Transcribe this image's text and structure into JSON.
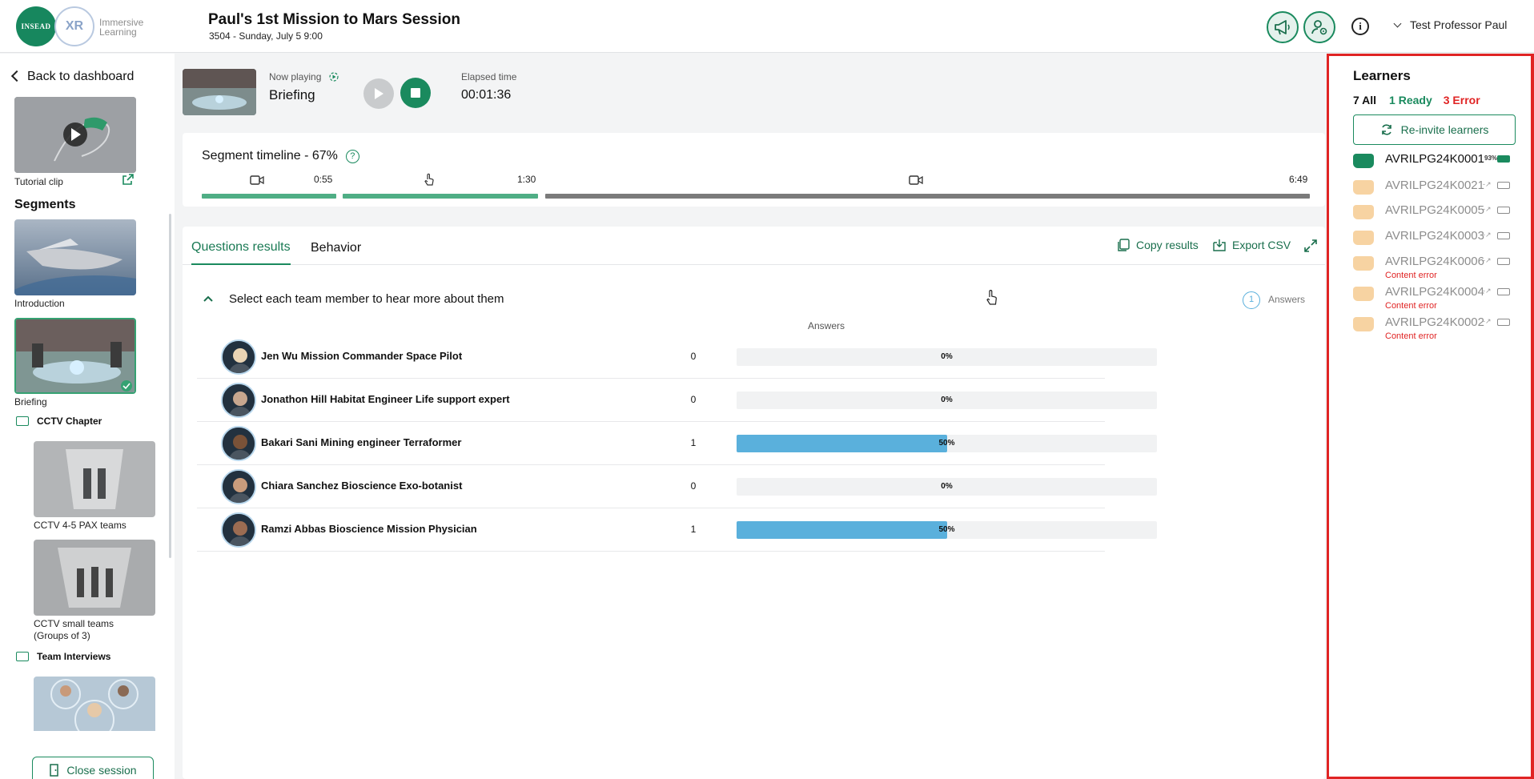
{
  "brand": {
    "logo_text": "INSEAD",
    "logo_mark": "XR",
    "tagline_1": "Immersive",
    "tagline_2": "Learning"
  },
  "session": {
    "title": "Paul's 1st Mission to Mars Session",
    "subtitle": "3504 - Sunday, July 5  9:00"
  },
  "header": {
    "user_name": "Test Professor Paul",
    "icons": [
      "megaphone-icon",
      "user-settings-icon",
      "info-icon",
      "chevron-down-icon"
    ]
  },
  "sidebar": {
    "back_label": "Back to dashboard",
    "tutorial_label": "Tutorial clip",
    "segments_heading": "Segments",
    "segments": [
      {
        "label": "Introduction"
      },
      {
        "label": "Briefing",
        "active": true,
        "completed": true
      }
    ],
    "folders": [
      {
        "label": "CCTV Chapter",
        "items": [
          {
            "label": "CCTV 4-5 PAX teams"
          },
          {
            "label_1": "CCTV small teams",
            "label_2": "(Groups of 3)"
          }
        ]
      },
      {
        "label": "Team Interviews"
      }
    ],
    "close_label": "Close session"
  },
  "player": {
    "now_playing_label": "Now playing",
    "now_playing_value": "Briefing",
    "elapsed_label": "Elapsed time",
    "elapsed_value": "00:01:36"
  },
  "timeline": {
    "title": "Segment timeline - 67%",
    "help": "?",
    "progress": 0.67,
    "markers": [
      {
        "icon": "video-icon"
      },
      {
        "time": "0:55"
      },
      {
        "icon": "touch-icon"
      },
      {
        "time": "1:30"
      },
      {
        "icon": "video-icon"
      },
      {
        "time": "6:49"
      }
    ]
  },
  "results": {
    "tabs": [
      {
        "label": "Questions results",
        "active": true
      },
      {
        "label": "Behavior",
        "active": false
      }
    ],
    "copy_label": "Copy results",
    "export_label": "Export CSV",
    "question": "Select each team member to hear more about them",
    "answers_count": "1",
    "answers_label": "Answers",
    "column_answers": "Answers",
    "rows": [
      {
        "name": "Jen Wu Mission Commander Space Pilot",
        "count": "0",
        "pct_label": "0%",
        "pct": 0
      },
      {
        "name": "Jonathon Hill Habitat Engineer Life support expert",
        "count": "0",
        "pct_label": "0%",
        "pct": 0
      },
      {
        "name": "Bakari Sani Mining engineer Terraformer",
        "count": "1",
        "pct_label": "50%",
        "pct": 50
      },
      {
        "name": "Chiara Sanchez Bioscience Exo-botanist",
        "count": "0",
        "pct_label": "0%",
        "pct": 0
      },
      {
        "name": "Ramzi Abbas Bioscience Mission Physician",
        "count": "1",
        "pct_label": "50%",
        "pct": 50
      }
    ]
  },
  "learners": {
    "heading": "Learners",
    "all": "7 All",
    "ready": "1 Ready",
    "error": "3 Error",
    "reinvite_label": "Re-invite learners",
    "list": [
      {
        "id": "AVRILPG24K0001",
        "status": "ready",
        "battery": "93%",
        "error": ""
      },
      {
        "id": "AVRILPG24K0021",
        "status": "offline",
        "battery": "",
        "error": ""
      },
      {
        "id": "AVRILPG24K0005",
        "status": "offline",
        "battery": "",
        "error": ""
      },
      {
        "id": "AVRILPG24K0003",
        "status": "offline",
        "battery": "",
        "error": ""
      },
      {
        "id": "AVRILPG24K0006",
        "status": "offline",
        "battery": "",
        "error": "Content error"
      },
      {
        "id": "AVRILPG24K0004",
        "status": "offline",
        "battery": "",
        "error": "Content error"
      },
      {
        "id": "AVRILPG24K0002",
        "status": "offline",
        "battery": "",
        "error": "Content error"
      }
    ]
  },
  "colors": {
    "brand_green": "#1a8a5e",
    "bar_blue": "#5ab0dc",
    "error_red": "#e02424",
    "offline_headset": "#f7d3a2"
  }
}
